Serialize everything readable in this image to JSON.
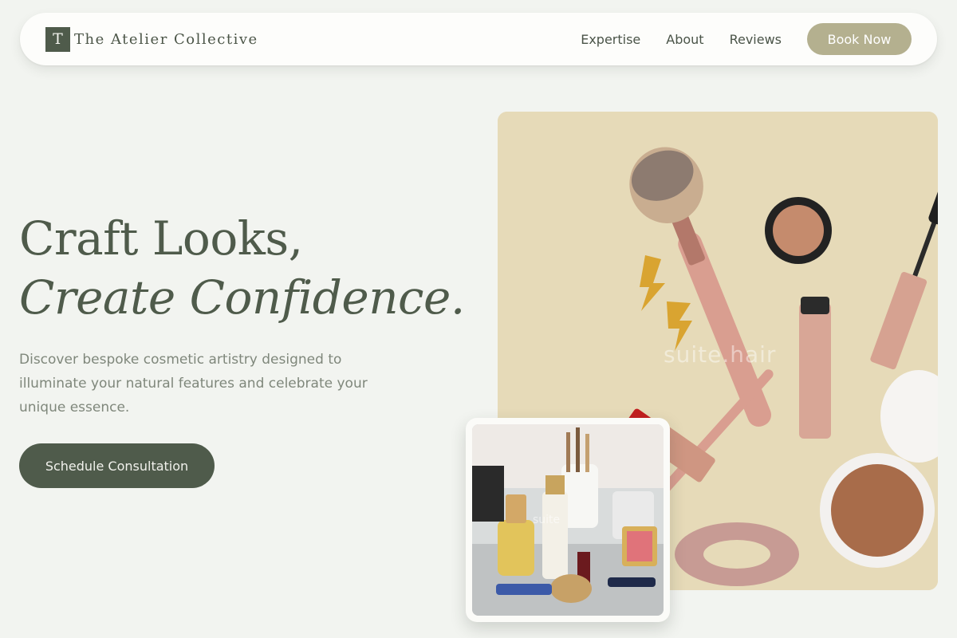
{
  "brand": {
    "logo_letter": "T",
    "name": "The Atelier Collective"
  },
  "nav": {
    "links": [
      "Expertise",
      "About",
      "Reviews"
    ],
    "book_label": "Book Now"
  },
  "hero": {
    "title_line1": "Craft Looks,",
    "title_line2": "Create Confidence.",
    "description": "Discover bespoke cosmetic artistry designed to illuminate your natural features and celebrate your unique essence.",
    "cta_label": "Schedule Consultation"
  },
  "images": {
    "main_watermark": "suite.hair",
    "inset_watermark": "suite"
  },
  "colors": {
    "background": "#f2f4f0",
    "primary": "#4f5b4b",
    "accent": "#b4b08f",
    "hero_image_bg": "#e6dab8"
  },
  "icons": {
    "logo": "monogram-logo-icon"
  }
}
